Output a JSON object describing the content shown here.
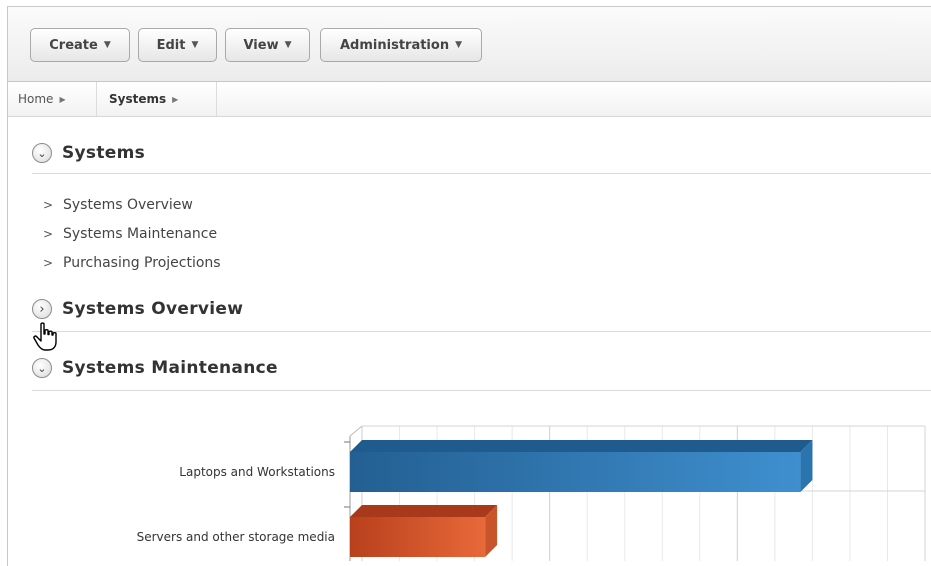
{
  "toolbar": {
    "menus": [
      {
        "label": "Create",
        "caret": "▼"
      },
      {
        "label": "Edit",
        "caret": "▼"
      },
      {
        "label": "View",
        "caret": "▼"
      },
      {
        "label": "Administration",
        "caret": "▼"
      }
    ]
  },
  "breadcrumb": {
    "items": [
      {
        "label": "Home",
        "arrow": "▶"
      },
      {
        "label": "Systems",
        "arrow": "▶"
      }
    ]
  },
  "regions": {
    "systems": {
      "title": "Systems",
      "toggle": "⌄"
    },
    "systems_overview": {
      "title": "Systems Overview",
      "toggle": "›"
    },
    "systems_maintenance": {
      "title": "Systems Maintenance",
      "toggle": "⌄"
    }
  },
  "systems_links": [
    {
      "label": "Systems Overview",
      "chev": ">"
    },
    {
      "label": "Systems Maintenance",
      "chev": ">"
    },
    {
      "label": "Purchasing Projections",
      "chev": ">"
    }
  ],
  "icons": {
    "expanded": "chevron-down-icon",
    "collapsed": "chevron-right-icon",
    "cursor": "hand-pointer-icon"
  },
  "chart_data": {
    "type": "bar",
    "orientation": "horizontal",
    "categories": [
      "Laptops and Workstations",
      "Servers and other storage media"
    ],
    "values": [
      12,
      3.6
    ],
    "colors": [
      "#3f8fcf",
      "#e8693a"
    ],
    "xlim": [
      0,
      15
    ],
    "grid": true
  }
}
